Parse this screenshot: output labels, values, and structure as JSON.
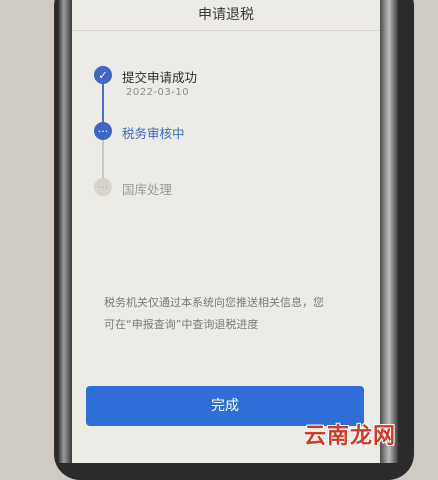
{
  "header": {
    "title": "申请退税"
  },
  "steps": [
    {
      "title": "提交申请成功",
      "date": "2022-03-10",
      "state": "done",
      "icon": "check-icon"
    },
    {
      "title": "税务审核中",
      "state": "active",
      "icon": "ellipsis-icon"
    },
    {
      "title": "国库处理",
      "state": "pending",
      "icon": "ellipsis-icon"
    }
  ],
  "info": {
    "line1": "税务机关仅通过本系统向您推送相关信息，您",
    "line2": "可在“申报查询”中查询退税进度"
  },
  "done_button": {
    "label": "完成"
  },
  "watermark": {
    "text": "云南龙网"
  },
  "colors": {
    "accent": "#2f6ed6",
    "step_active": "#3f67c4",
    "step_pending": "#d6d4cd",
    "watermark": "#d33a2a"
  }
}
